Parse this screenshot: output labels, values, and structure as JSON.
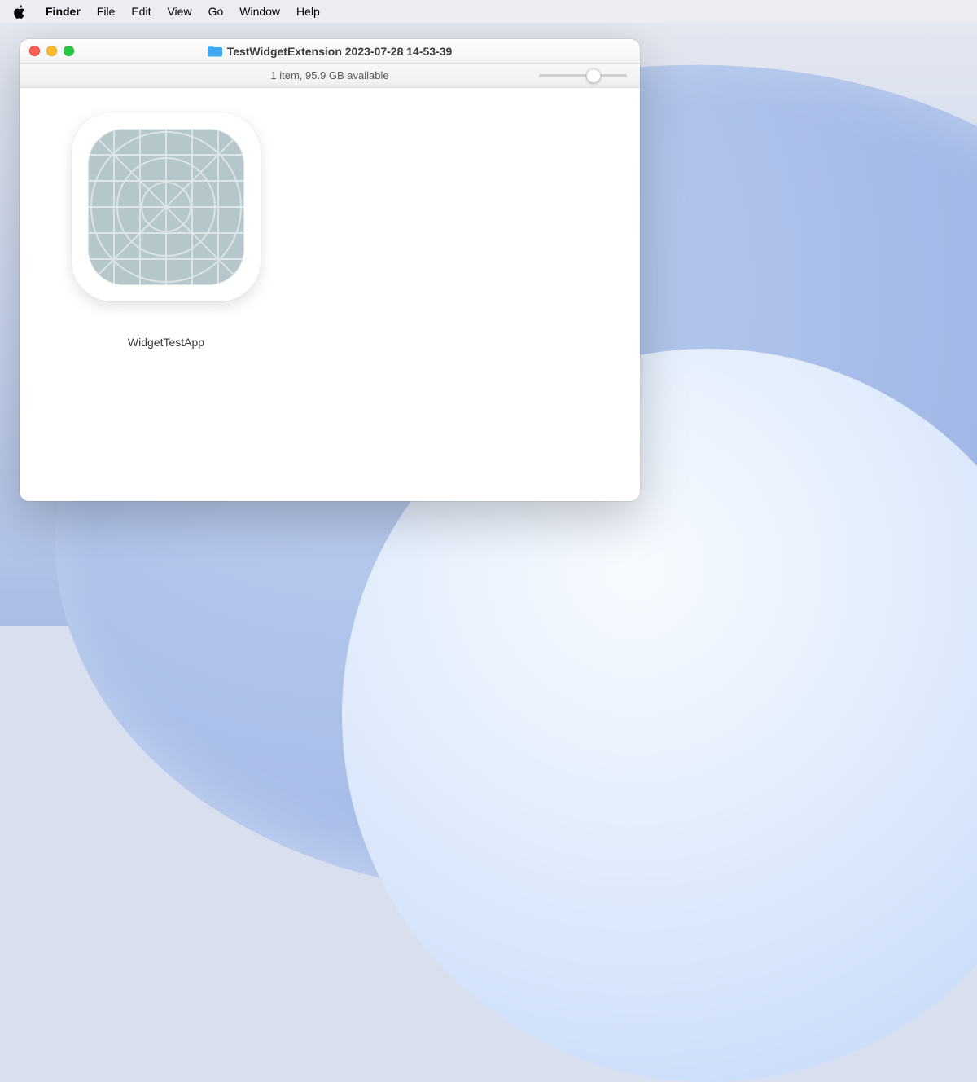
{
  "menubar": {
    "app": "Finder",
    "items": [
      "File",
      "Edit",
      "View",
      "Go",
      "Window",
      "Help"
    ]
  },
  "window": {
    "title": "TestWidgetExtension 2023-07-28 14-53-39",
    "status": "1 item, 95.9 GB available"
  },
  "files": [
    {
      "name": "WidgetTestApp",
      "kind": "app-placeholder"
    }
  ],
  "colors": {
    "appIconFill": "#b6c7cb",
    "appIconGrid": "#d6e0e2"
  }
}
